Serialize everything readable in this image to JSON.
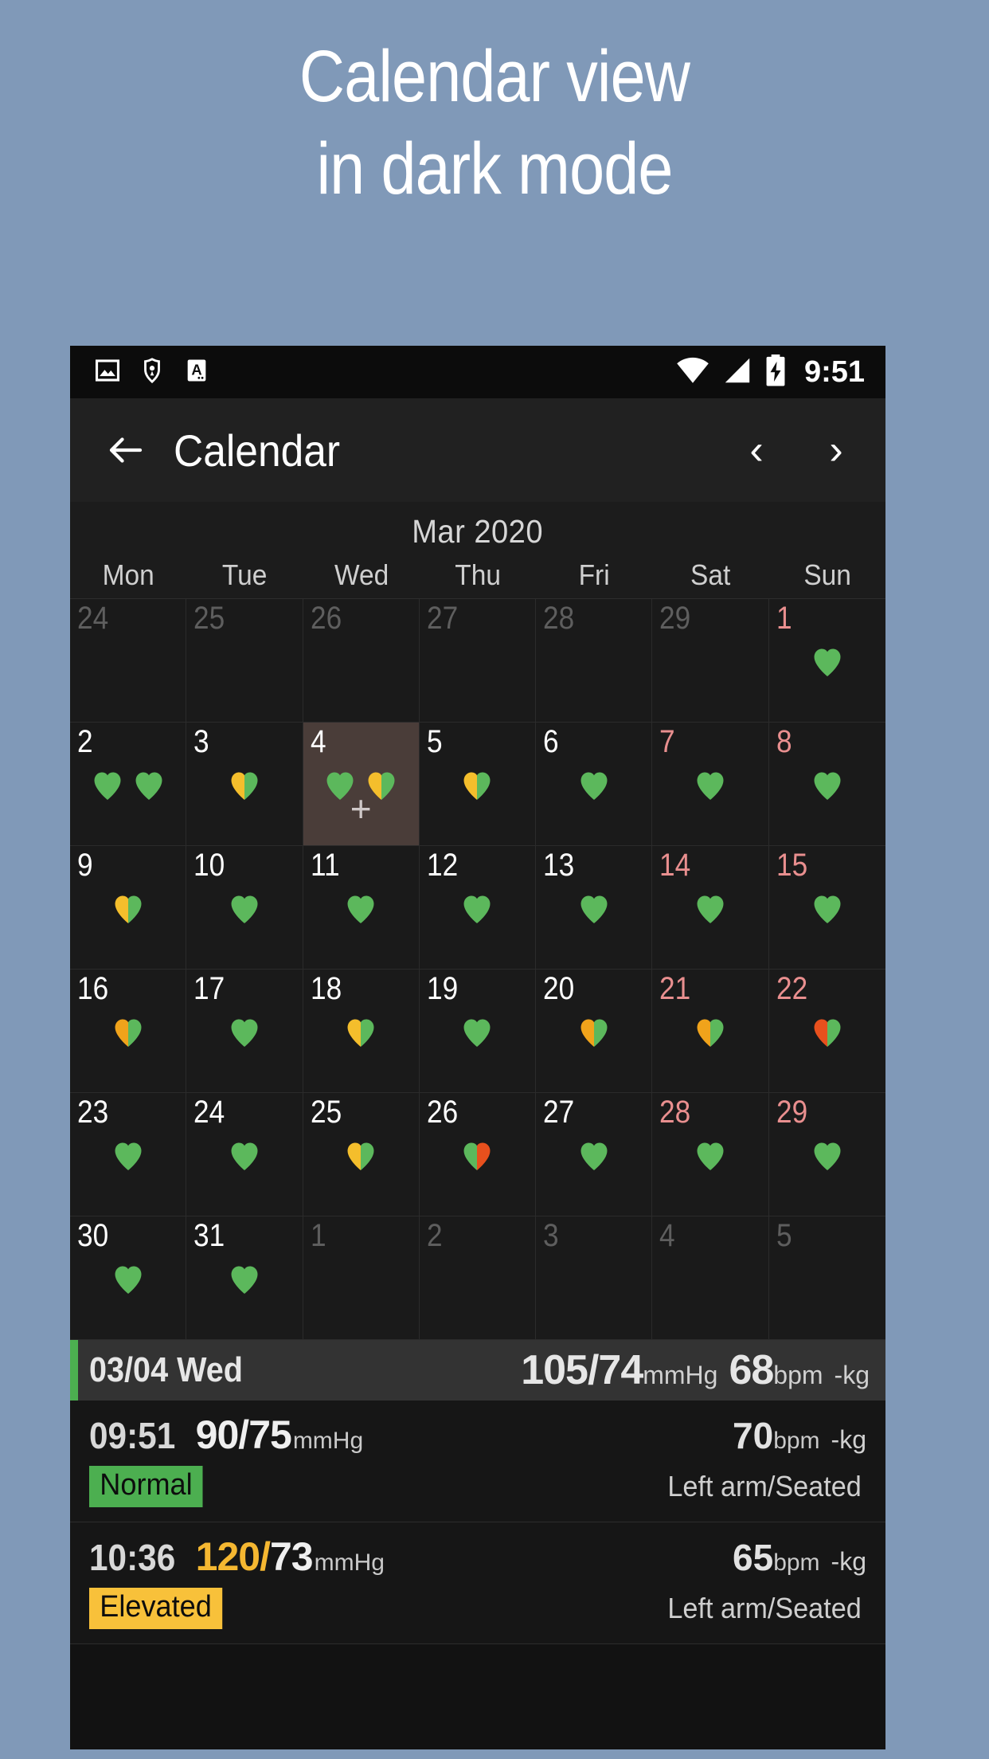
{
  "promo": {
    "line1": "Calendar view",
    "line2": "in dark mode"
  },
  "statusbar": {
    "icons": [
      "image-icon",
      "shield-location-icon",
      "font-a-icon",
      "wifi-icon",
      "cell-signal-icon",
      "battery-charging-icon"
    ],
    "time": "9:51"
  },
  "appbar": {
    "back_label": "←",
    "title": "Calendar",
    "prev_label": "‹",
    "next_label": "›"
  },
  "calendar": {
    "month": "Mar 2020",
    "weekdays": [
      "Mon",
      "Tue",
      "Wed",
      "Thu",
      "Fri",
      "Sat",
      "Sun"
    ],
    "selected_day": "4",
    "plus_label": "+",
    "colors": {
      "green": "#5cb85c",
      "yellow": "#f4be2c",
      "orange": "#f0a31b",
      "red": "#e8501d",
      "selected_bg": "#4a3d39",
      "weekend_text": "#e98f8f",
      "dim_text": "#5e5e5e"
    },
    "cells": [
      {
        "num": "24",
        "state": "dim",
        "hearts": []
      },
      {
        "num": "25",
        "state": "dim",
        "hearts": []
      },
      {
        "num": "26",
        "state": "dim",
        "hearts": []
      },
      {
        "num": "27",
        "state": "dim",
        "hearts": []
      },
      {
        "num": "28",
        "state": "dim",
        "hearts": []
      },
      {
        "num": "29",
        "state": "dim",
        "hearts": []
      },
      {
        "num": "1",
        "state": "weekend",
        "hearts": [
          {
            "left": "green",
            "right": "green"
          }
        ]
      },
      {
        "num": "2",
        "state": "normal",
        "hearts": [
          {
            "left": "green",
            "right": "green"
          },
          {
            "left": "green",
            "right": "green"
          }
        ]
      },
      {
        "num": "3",
        "state": "normal",
        "hearts": [
          {
            "left": "yellow",
            "right": "green"
          }
        ]
      },
      {
        "num": "4",
        "state": "selected",
        "hearts": [
          {
            "left": "green",
            "right": "green"
          },
          {
            "left": "yellow",
            "right": "green"
          }
        ],
        "plus": true
      },
      {
        "num": "5",
        "state": "normal",
        "hearts": [
          {
            "left": "yellow",
            "right": "green"
          }
        ]
      },
      {
        "num": "6",
        "state": "normal",
        "hearts": [
          {
            "left": "green",
            "right": "green"
          }
        ]
      },
      {
        "num": "7",
        "state": "weekend",
        "hearts": [
          {
            "left": "green",
            "right": "green"
          }
        ]
      },
      {
        "num": "8",
        "state": "weekend",
        "hearts": [
          {
            "left": "green",
            "right": "green"
          }
        ]
      },
      {
        "num": "9",
        "state": "normal",
        "hearts": [
          {
            "left": "yellow",
            "right": "green"
          }
        ]
      },
      {
        "num": "10",
        "state": "normal",
        "hearts": [
          {
            "left": "green",
            "right": "green"
          }
        ]
      },
      {
        "num": "11",
        "state": "normal",
        "hearts": [
          {
            "left": "green",
            "right": "green"
          }
        ]
      },
      {
        "num": "12",
        "state": "normal",
        "hearts": [
          {
            "left": "green",
            "right": "green"
          }
        ]
      },
      {
        "num": "13",
        "state": "normal",
        "hearts": [
          {
            "left": "green",
            "right": "green"
          }
        ]
      },
      {
        "num": "14",
        "state": "weekend",
        "hearts": [
          {
            "left": "green",
            "right": "green"
          }
        ]
      },
      {
        "num": "15",
        "state": "weekend",
        "hearts": [
          {
            "left": "green",
            "right": "green"
          }
        ]
      },
      {
        "num": "16",
        "state": "normal",
        "hearts": [
          {
            "left": "orange",
            "right": "green"
          }
        ]
      },
      {
        "num": "17",
        "state": "normal",
        "hearts": [
          {
            "left": "green",
            "right": "green"
          }
        ]
      },
      {
        "num": "18",
        "state": "normal",
        "hearts": [
          {
            "left": "yellow",
            "right": "green"
          }
        ]
      },
      {
        "num": "19",
        "state": "normal",
        "hearts": [
          {
            "left": "green",
            "right": "green"
          }
        ]
      },
      {
        "num": "20",
        "state": "normal",
        "hearts": [
          {
            "left": "orange",
            "right": "green"
          }
        ]
      },
      {
        "num": "21",
        "state": "weekend",
        "hearts": [
          {
            "left": "orange",
            "right": "green"
          }
        ]
      },
      {
        "num": "22",
        "state": "weekend",
        "hearts": [
          {
            "left": "red",
            "right": "green"
          }
        ]
      },
      {
        "num": "23",
        "state": "normal",
        "hearts": [
          {
            "left": "green",
            "right": "green"
          }
        ]
      },
      {
        "num": "24",
        "state": "normal",
        "hearts": [
          {
            "left": "green",
            "right": "green"
          }
        ]
      },
      {
        "num": "25",
        "state": "normal",
        "hearts": [
          {
            "left": "yellow",
            "right": "green"
          }
        ]
      },
      {
        "num": "26",
        "state": "normal",
        "hearts": [
          {
            "left": "green",
            "right": "red"
          }
        ]
      },
      {
        "num": "27",
        "state": "normal",
        "hearts": [
          {
            "left": "green",
            "right": "green"
          }
        ]
      },
      {
        "num": "28",
        "state": "weekend",
        "hearts": [
          {
            "left": "green",
            "right": "green"
          }
        ]
      },
      {
        "num": "29",
        "state": "weekend",
        "hearts": [
          {
            "left": "green",
            "right": "green"
          }
        ]
      },
      {
        "num": "30",
        "state": "normal",
        "hearts": [
          {
            "left": "green",
            "right": "green"
          }
        ]
      },
      {
        "num": "31",
        "state": "normal",
        "hearts": [
          {
            "left": "green",
            "right": "green"
          }
        ]
      },
      {
        "num": "1",
        "state": "dim",
        "hearts": []
      },
      {
        "num": "2",
        "state": "dim",
        "hearts": []
      },
      {
        "num": "3",
        "state": "dim",
        "hearts": []
      },
      {
        "num": "4",
        "state": "dim",
        "hearts": []
      },
      {
        "num": "5",
        "state": "dim",
        "hearts": []
      }
    ]
  },
  "summary": {
    "date": "03/04 Wed",
    "bp": "105/74",
    "bp_unit": "mmHg",
    "pulse": "68",
    "pulse_unit": "bpm",
    "weight": "-",
    "weight_unit": "kg",
    "accent_color": "#4caf50"
  },
  "readings": [
    {
      "time": "09:51",
      "systolic": "90",
      "slash": "/",
      "diastolic": "75",
      "bp_unit": "mmHg",
      "systolic_warn": false,
      "pulse": "70",
      "pulse_unit": "bpm",
      "weight": "-",
      "weight_unit": "kg",
      "badge": "Normal",
      "badge_type": "normal",
      "posture": "Left arm/Seated"
    },
    {
      "time": "10:36",
      "systolic": "120",
      "slash": "/",
      "diastolic": "73",
      "bp_unit": "mmHg",
      "systolic_warn": true,
      "pulse": "65",
      "pulse_unit": "bpm",
      "weight": "-",
      "weight_unit": "kg",
      "badge": "Elevated",
      "badge_type": "elevated",
      "posture": "Left arm/Seated"
    }
  ]
}
